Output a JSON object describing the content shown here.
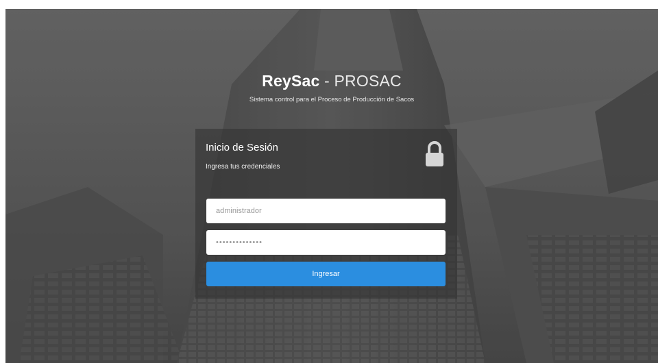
{
  "header": {
    "brand_strong": "ReySac",
    "brand_separator": " - ",
    "brand_light": "PROSAC",
    "subtitle": "Sistema control para el Proceso de Producción de Sacos"
  },
  "login": {
    "title": "Inicio de Sesión",
    "subtitle": "Ingresa tus credenciales",
    "username_value": "administrador",
    "password_value": "••••••••••••••",
    "submit_label": "Ingresar",
    "icon": "lock-icon"
  },
  "colors": {
    "primary_button": "#2b8ee0",
    "card_overlay": "rgba(52,52,52,0.62)",
    "background": "#5b5b5b"
  }
}
